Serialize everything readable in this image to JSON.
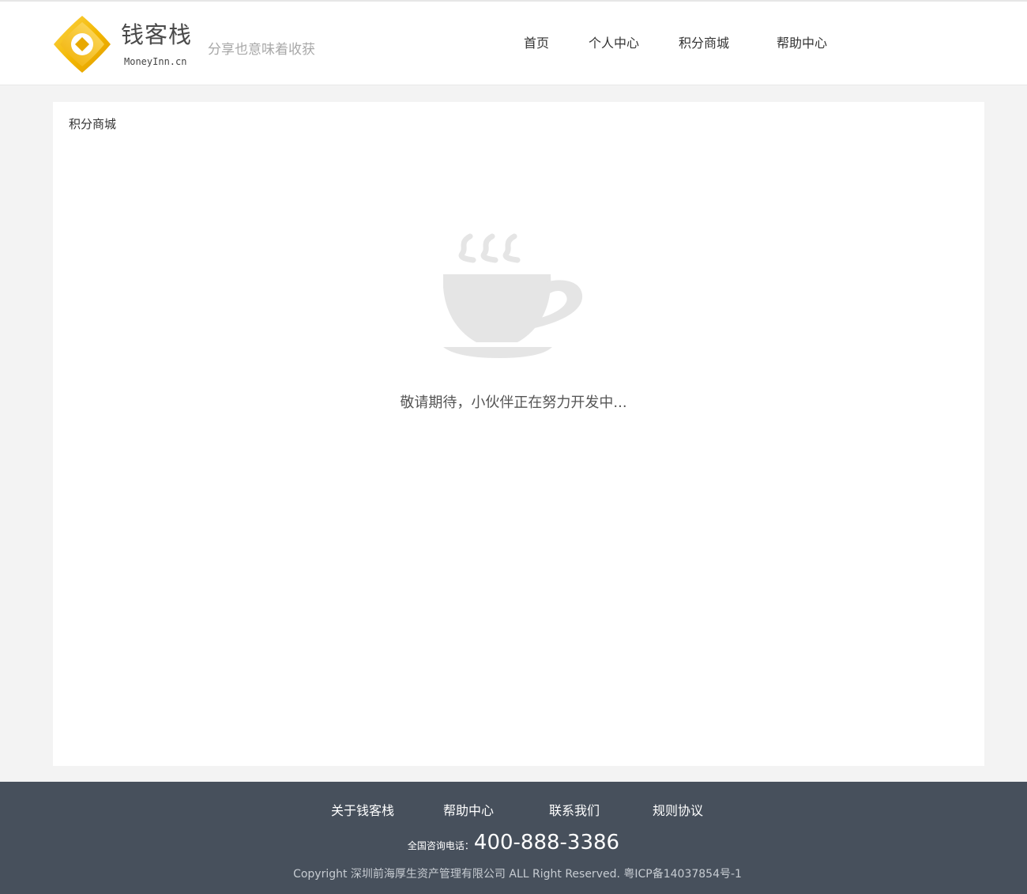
{
  "header": {
    "brand_name": "钱客栈",
    "brand_domain": "MoneyInn.cn",
    "slogan": "分享也意味着收获",
    "nav": {
      "home": "首页",
      "personal_center": "个人中心",
      "points_mall": "积分商城",
      "help_center": "帮助中心"
    }
  },
  "main": {
    "breadcrumb": "积分商城",
    "message": "敬请期待，小伙伴正在努力开发中..."
  },
  "footer": {
    "links": {
      "about": "关于钱客栈",
      "help": "帮助中心",
      "contact": "联系我们",
      "rules": "规则协议"
    },
    "phone_label": "全国咨询电话：",
    "phone_number": "400-888-3386",
    "copyright": "Copyright  深圳前海厚生资产管理有限公司  ALL Right Reserved. 粤ICP备14037854号-1"
  },
  "colors": {
    "logo_gold": "#f2b600",
    "footer_bg": "#47505c",
    "placeholder_gray": "#e5e5e5"
  }
}
